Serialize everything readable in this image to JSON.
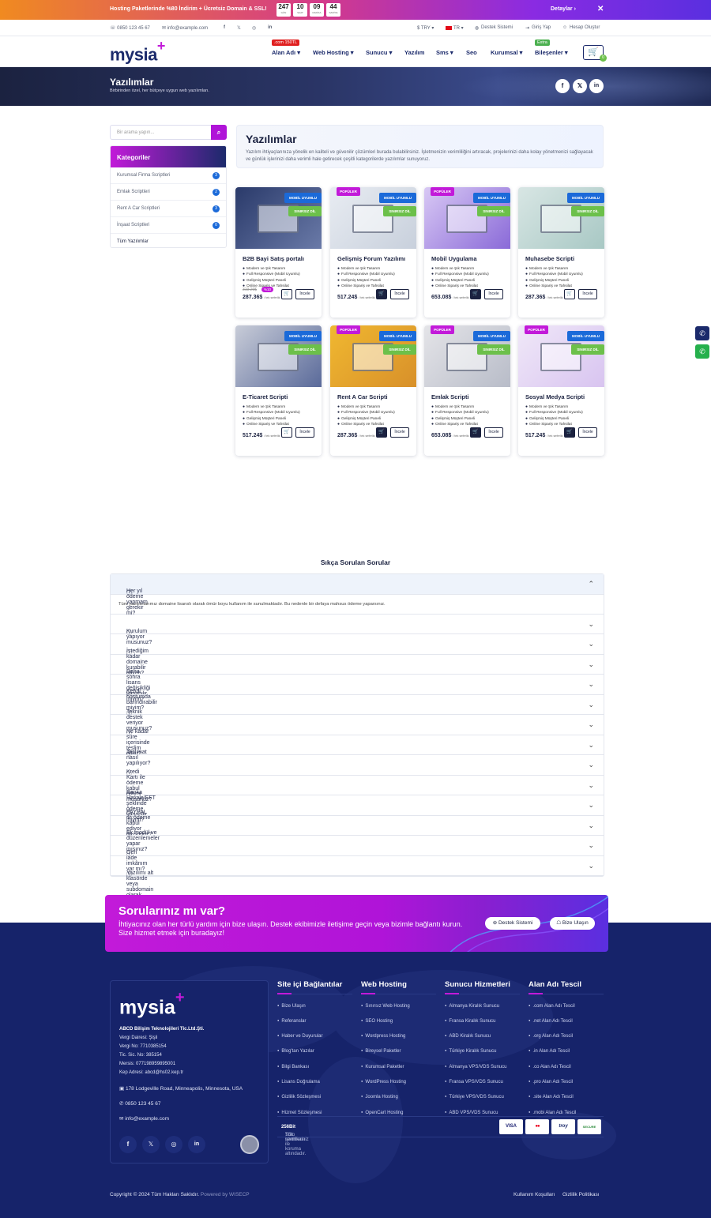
{
  "promo": {
    "text": "Hosting Paketlerinde %80 İndirim + Ücretsiz Domain & SSL!",
    "countdown": [
      {
        "v": "247",
        "l": "GÜN"
      },
      {
        "v": "10",
        "l": "SAAT"
      },
      {
        "v": "09",
        "l": "DAKİKA"
      },
      {
        "v": "44",
        "l": "SANİYE"
      }
    ],
    "details": "Detaylar ›",
    "close": "✕"
  },
  "topbar": {
    "phone": "☏ 0850 123 45 67",
    "email": "✉ info@example.com",
    "currency": "$ TRY ▾",
    "lang": "TR ▾",
    "support": "Destek Sistemi",
    "login": "Giriş Yap",
    "register": "Hesap Oluştur"
  },
  "header": {
    "logo": "mysia",
    "logo_plus": "+",
    "nav": [
      "Alan Adı ▾",
      "Web Hosting ▾",
      "Sunucu ▾",
      "Yazılım",
      "Sms ▾",
      "Seo",
      "Kurumsal ▾",
      "Bileşenler ▾"
    ],
    "badge_com": ".com 150TL",
    "badge_extra": "Extra",
    "cart_count": "0"
  },
  "hero": {
    "title": "Yazılımlar",
    "subtitle": "Birbirinden özel, her bütçeye uygun web yazılımları."
  },
  "search": {
    "placeholder": "Bir arama yapın..."
  },
  "categories": {
    "title": "Kategoriler",
    "items": [
      {
        "label": "Kurumsal Firma Scriptleri",
        "count": "3"
      },
      {
        "label": "Emlak Scriptleri",
        "count": "2"
      },
      {
        "label": "Rent A Car Scriptleri",
        "count": "3"
      },
      {
        "label": "İnşaat Scriptleri",
        "count": "0"
      },
      {
        "label": "Tüm Yazılımlar",
        "count": ""
      }
    ]
  },
  "intro": {
    "title": "Yazılımlar",
    "text": "Yazılım ihtiyaçlarınıza yönelik en kaliteli ve güvenilir çözümleri burada bulabilirsiniz. İşletmenizin verimliliğini artıracak, projelerinizi daha kolay yönetmenizi sağlayacak ve günlük işlerinizi daha verimli hale getirecek çeşitli kategorilerde yazılımlar sunuyoruz."
  },
  "tags": {
    "mobile": "MOBİL UYUMLU",
    "unlimited": "SINIRSIZ DİL",
    "popular": "POPÜLER"
  },
  "features": [
    "Modern ve Şık Tasarım",
    "Full Responsive (Mobil Uyumlu)",
    "Gelişmiş Müşteri Paneli",
    "Online Sipariş ve Tahsilat"
  ],
  "per": "/ tek seferlik",
  "inspect": "İncele",
  "products": [
    {
      "name": "B2B Bayi Satış portalı",
      "price": "287.36$",
      "old": "319.29$",
      "discount": "%10",
      "popular": false
    },
    {
      "name": "Gelişmiş Forum Yazılımı",
      "price": "517.24$",
      "popular": true
    },
    {
      "name": "Mobil Uygulama",
      "price": "653.08$",
      "popular": true
    },
    {
      "name": "Muhasebe Scripti",
      "price": "287.36$",
      "popular": false
    },
    {
      "name": "E-Ticaret Scripti",
      "price": "517.24$",
      "popular": false
    },
    {
      "name": "Rent A Car Scripti",
      "price": "287.36$",
      "popular": true
    },
    {
      "name": "Emlak Scripti",
      "price": "653.08$",
      "popular": true
    },
    {
      "name": "Sosyal Medya Scripti",
      "price": "517.24$",
      "popular": true
    }
  ],
  "faq": {
    "title": "Sıkça Sorulan Sorular",
    "answer": "Tüm yazılımlarımız domaine lisanslı olarak ömür boyu kullanım ile sunulmaktadır. Bu nedenle bir defaya mahsus ödeme yaparsınız.",
    "items": [
      "Her yıl ödeme yapmam gerekir mi?",
      "Kurulum yapıyor musunuz?",
      "İstediğim kadar domaine kurabilir miyim?",
      "Daha sonra lisans değişikliği yapabilir miyim?",
      "Kendi hostumda barındırabilir miyim?",
      "Teknik destek veriyor musunuz?",
      "Ne kadar süre içerisinde teslim edilir?",
      "Teslimat nasıl yapılıyor?",
      "Kredi Kartı ile ödeme kabul ediyor musunuz?",
      "Banka Havale/EFT şeklinde ödeme yapabilir miyim?",
      "PAYPAL ile ödeme kabul ediyor musunuz?",
      "Ek modül ve düzenlemeler yapar mısınız?",
      "Geri iade imkânım var mı?",
      "Yazılımı alt klasörde veya subdomain olarak çalıştırabilir miyim?"
    ]
  },
  "cta": {
    "title": "Sorularınız mı var?",
    "text": "İhtiyacınız olan her türlü yardım için bize ulaşın. Destek ekibimizle iletişime geçin veya bizimle bağlantı kurun. Size hizmet etmek için buradayız!",
    "support": "Destek Sistemi",
    "contact": "Bize Ulaşın"
  },
  "footer": {
    "logo": "mysia",
    "logo_plus": "+",
    "company": "ABCD Bilişim Teknolojileri Tic.Ltd.Şti.",
    "tax_office": "Vergi Dairesi: Şişli",
    "tax_no": "Vergi No: 7710385154",
    "trade_no": "Tic. Sic. No: 385154",
    "mersis": "Mersis: 077198959895001",
    "kep": "Kep Adresi: abcd@hs02.kep.tr",
    "address": "178 Lodgeville Road, Minneapolis, Minnesota, USA",
    "phone": "0850 123 45 67",
    "email": "info@example.com",
    "cols": [
      {
        "title": "Site içi Bağlantılar",
        "items": [
          "Bize Ulaşın",
          "Referanslar",
          "Haber ve Duyurular",
          "Blog'tan Yazılar",
          "Bilgi Bankası",
          "Lisans Doğrulama",
          "Gizlilik Sözleşmesi",
          "Hizmet Sözleşmesi"
        ]
      },
      {
        "title": "Web Hosting",
        "items": [
          "Sınırsız Web Hosting",
          "SEO Hosting",
          "Wordpress Hosting",
          "Bireysel Paketler",
          "Kurumsal Paketler",
          "WordPress Hosting",
          "Joomla Hosting",
          "OpenCart Hosting"
        ]
      },
      {
        "title": "Sunucu Hizmetleri",
        "items": [
          "Almanya Kiralık Sunucu",
          "Fransa Kiralık Sunucu",
          "ABD Kiralık Sunucu",
          "Türkiye Kiralık Sunucu",
          "Almanya VPS/VDS Sunucu",
          "Fransa VPS/VDS Sunucu",
          "Türkiye VPS/VDS Sunucu",
          "ABD VPS/VDS Sunucu"
        ]
      },
      {
        "title": "Alan Adı Tescil",
        "items": [
          ".com Alan Adı Tescil",
          ".net Alan Adı Tescil",
          ".org Alan Adı Tescil",
          ".in Alan Adı Tescil",
          ".co Alan Adı Tescil",
          ".pro Alan Adı Tescil",
          ".site Alan Adı Tescil",
          ".mobi Alan Adı Tescil"
        ]
      }
    ],
    "ssl_pre": "Tüm işlemleriniz ",
    "ssl_bold": "256Bit",
    "ssl_post": " SSL sertifikası ile koruma altındadır.",
    "payments": [
      "VISA",
      "●●",
      "troy",
      "SECURE"
    ],
    "copyright": "Copyright © 2024 Tüm Hakları Saklıdır.",
    "powered": " Powered by WISECP",
    "terms": "Kullanım Koşulları",
    "privacy": "Gizlilik Politikası"
  }
}
